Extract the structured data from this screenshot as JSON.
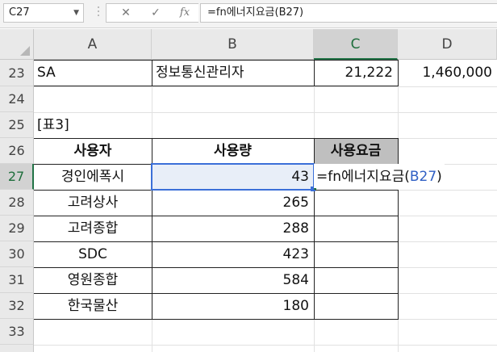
{
  "formula_bar": {
    "name_box": "C27",
    "cancel_icon": "✕",
    "enter_icon": "✓",
    "function_icon": "fx",
    "formula": "=fn에너지요금(B27)"
  },
  "columns": [
    "A",
    "B",
    "C",
    "D"
  ],
  "selected_column": "C",
  "rows": [
    {
      "num": "23",
      "a": "SA",
      "b": "정보통신관리자",
      "c": "21,222",
      "d": "1,460,000"
    },
    {
      "num": "24",
      "a": "",
      "b": "",
      "c": "",
      "d": ""
    },
    {
      "num": "25",
      "a": "[표3]",
      "b": "",
      "c": "",
      "d": ""
    },
    {
      "num": "26",
      "a": "사용자",
      "b": "사용량",
      "c": "사용요금",
      "d": ""
    },
    {
      "num": "27",
      "a": "경인에폭시",
      "b": "43",
      "c": "",
      "d": ""
    },
    {
      "num": "28",
      "a": "고려상사",
      "b": "265",
      "c": "",
      "d": ""
    },
    {
      "num": "29",
      "a": "고려종합",
      "b": "288",
      "c": "",
      "d": ""
    },
    {
      "num": "30",
      "a": "SDC",
      "b": "423",
      "c": "",
      "d": ""
    },
    {
      "num": "31",
      "a": "영원종합",
      "b": "584",
      "c": "",
      "d": ""
    },
    {
      "num": "32",
      "a": "한국물산",
      "b": "180",
      "c": "",
      "d": ""
    },
    {
      "num": "33",
      "a": "",
      "b": "",
      "c": "",
      "d": ""
    }
  ],
  "selected_row": "27",
  "editing_cell": {
    "prefix": "=fn에너지요금(",
    "ref": "B27",
    "suffix": ")",
    "ref_color": "#2f5fc4"
  },
  "colors": {
    "accent": "#217346",
    "ref_highlight": "#3b6fd8",
    "header_fill": "#bfbfbf"
  }
}
